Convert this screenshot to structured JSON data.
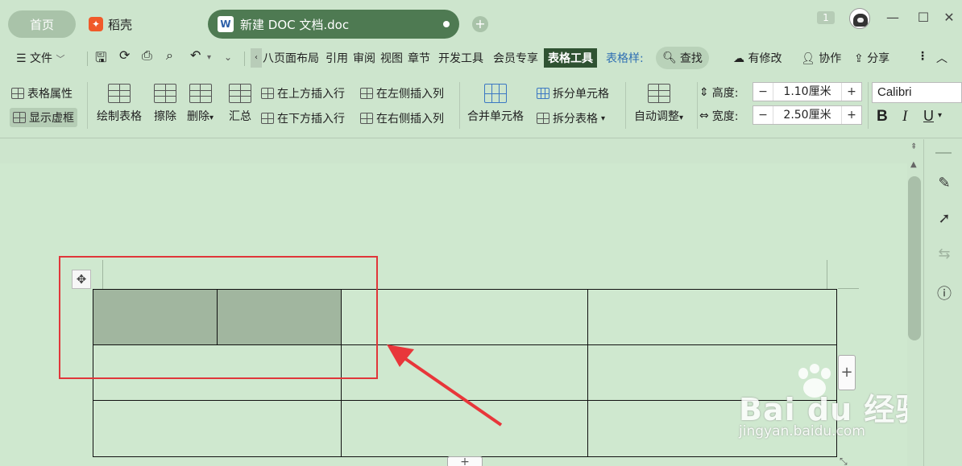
{
  "titlebar": {
    "home_tab": "首页",
    "docer_tab": "稻壳",
    "doc_tab": "新建 DOC 文档.doc",
    "doc_icon_letter": "W",
    "notification_count": "1"
  },
  "menu": {
    "file": "文件",
    "tabs": [
      "八",
      "页面布局",
      "引用",
      "审阅",
      "视图",
      "章节",
      "开发工具",
      "会员专享",
      "表格工具",
      "表格样式"
    ],
    "active_tab": "表格工具",
    "table_style_tab": "表格样:",
    "search": "查找",
    "has_changes": "有修改",
    "collaborate": "协作",
    "share": "分享"
  },
  "ribbon": {
    "table_props": "表格属性",
    "show_gridlines": "显示虚框",
    "draw_table": "绘制表格",
    "erase": "擦除",
    "delete": "删除",
    "summary": "汇总",
    "insert_row_above": "在上方插入行",
    "insert_row_below": "在下方插入行",
    "insert_col_left": "在左侧插入列",
    "insert_col_right": "在右侧插入列",
    "merge_cells": "合并单元格",
    "split_cells": "拆分单元格",
    "split_table": "拆分表格",
    "auto_fit": "自动调整",
    "height_label": "高度:",
    "height_value": "1.10厘米",
    "width_label": "宽度:",
    "width_value": "2.50厘米",
    "font": "Calibri",
    "bold": "B",
    "italic": "I",
    "underline": "U"
  },
  "watermark": {
    "brand": "Bai du 经验",
    "url": "jingyan.baidu.com"
  },
  "colors": {
    "accent": "#4e7a52",
    "active_tab": "#2f5232",
    "selection": "#a1b69f",
    "highlight": "#e0363a"
  }
}
